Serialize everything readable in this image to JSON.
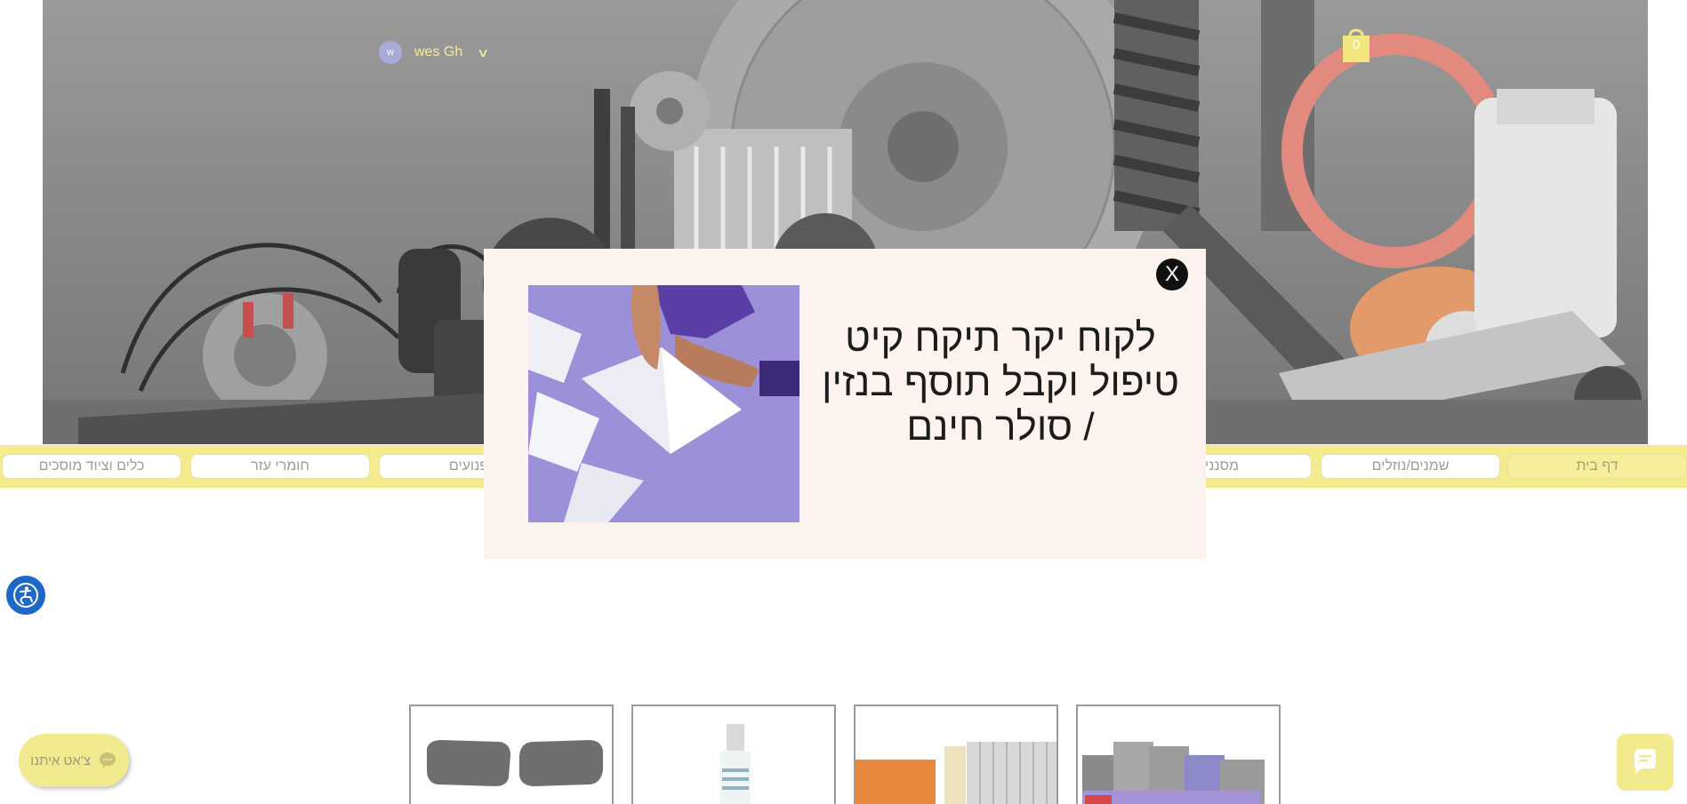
{
  "header": {
    "user": {
      "avatar_initial": "w",
      "name": "wes Gh"
    },
    "cart": {
      "count": "0"
    }
  },
  "nav": {
    "items": [
      {
        "label": "דף בית",
        "active": true
      },
      {
        "label": "שמנים/נוזלים",
        "active": false
      },
      {
        "label": "מסנני",
        "active": false
      },
      {
        "label": "",
        "active": false
      },
      {
        "label": "פנועים",
        "active": false
      },
      {
        "label": "חומרי עזר",
        "active": false
      },
      {
        "label": "כלים וציוד מוסכים",
        "active": false
      }
    ]
  },
  "modal": {
    "close_label": "X",
    "headline": "לקוח יקר תיקח קיט טיפול וקבל תוסף בנזין / סולר חינם"
  },
  "chat": {
    "label": "צ'אט איתנו"
  },
  "colors": {
    "accent_yellow": "#f4ec8c",
    "modal_bg": "#fcf3ee",
    "a11y_blue": "#1e68c7"
  }
}
